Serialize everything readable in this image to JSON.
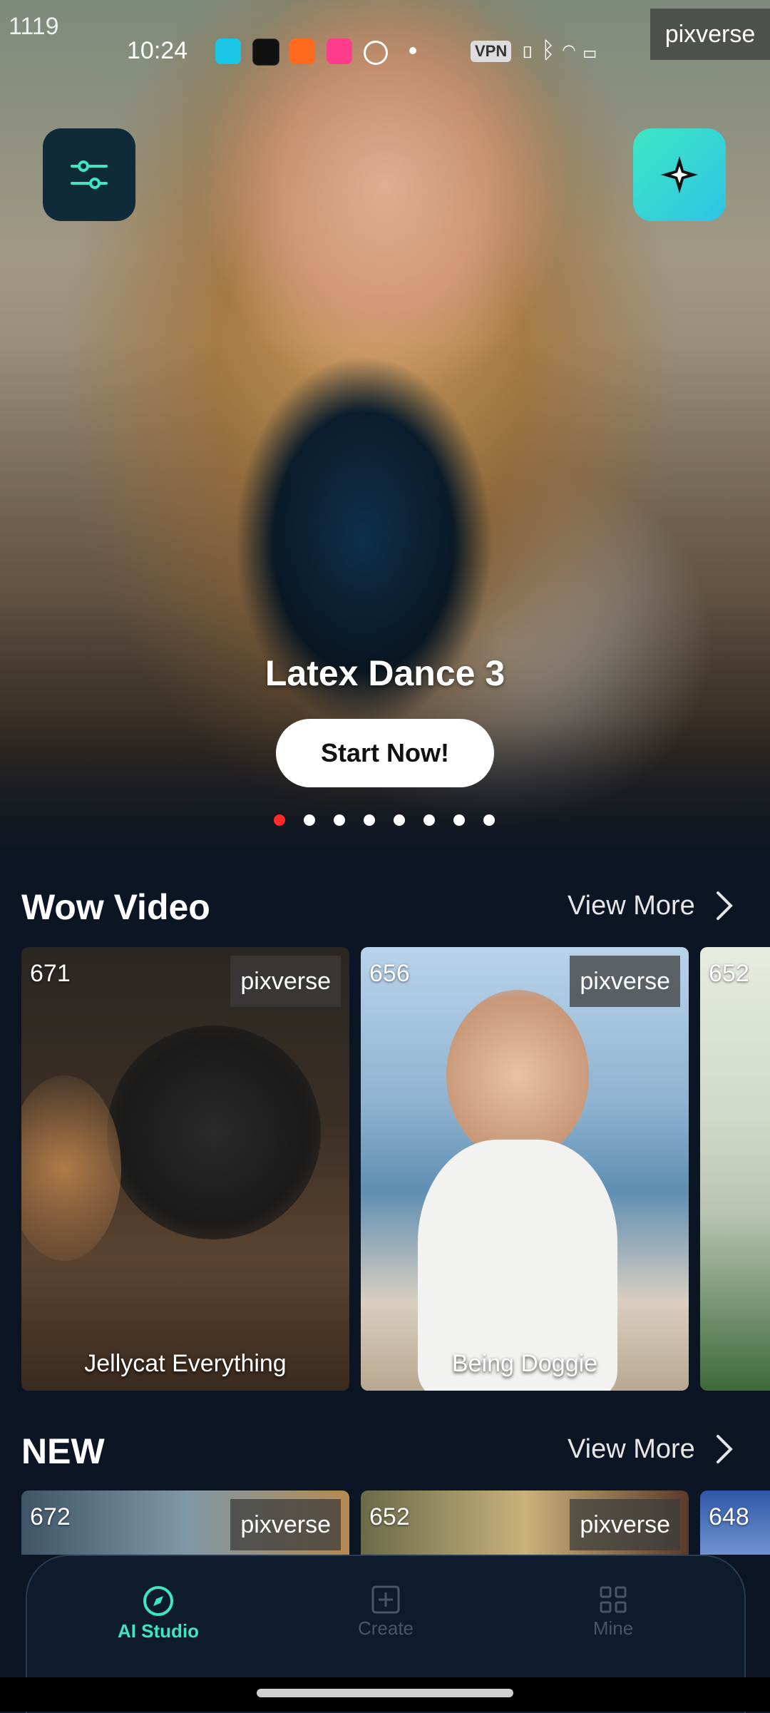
{
  "overlay": {
    "frame_number": "1119",
    "watermark": "pixverse"
  },
  "status_bar": {
    "time": "10:24",
    "vpn_label": "VPN"
  },
  "hero": {
    "title": "Latex Dance 3",
    "cta_label": "Start Now!",
    "pager_total": 8,
    "pager_active_index": 0
  },
  "wow_video": {
    "title": "Wow Video",
    "view_more": "View More",
    "cards": [
      {
        "count": "671",
        "watermark": "pixverse",
        "label": "Jellycat Everything"
      },
      {
        "count": "656",
        "watermark": "pixverse",
        "label": "Being Doggie"
      },
      {
        "count": "652",
        "watermark": "",
        "label": ""
      }
    ]
  },
  "new_section": {
    "title": "NEW",
    "view_more": "View More",
    "cards": [
      {
        "count": "672",
        "watermark": "pixverse"
      },
      {
        "count": "652",
        "watermark": "pixverse"
      },
      {
        "count": "648",
        "watermark": ""
      }
    ]
  },
  "bottom_nav": {
    "items": [
      {
        "label": "AI Studio",
        "icon": "compass-icon",
        "active": true
      },
      {
        "label": "Create",
        "icon": "plus-square-icon",
        "active": false
      },
      {
        "label": "Mine",
        "icon": "grid-icon",
        "active": false
      }
    ]
  },
  "colors": {
    "accent": "#3fe6c2",
    "background": "#0b1524",
    "pager_active": "#ff2a2a"
  }
}
